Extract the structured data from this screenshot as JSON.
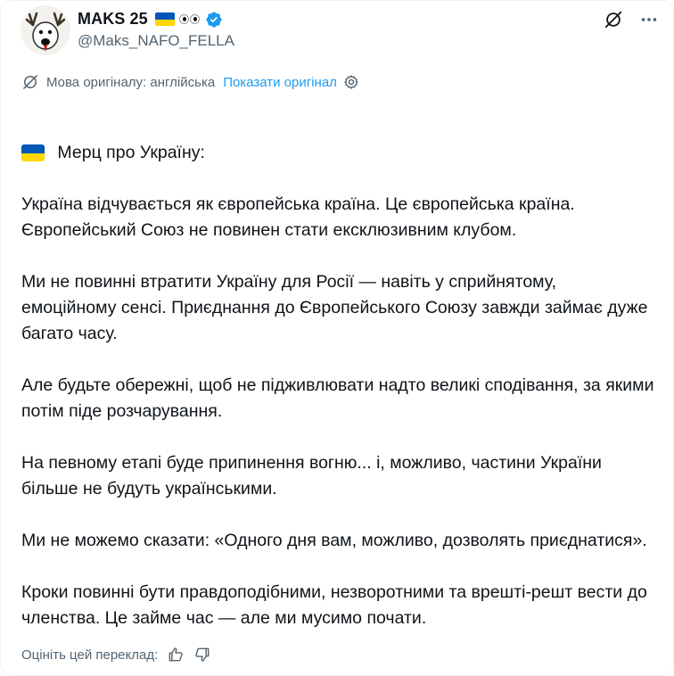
{
  "author": {
    "display_name": "MAKS 25",
    "handle": "@Maks_NAFO_FELLA"
  },
  "header_icons": [
    "grok-slash-icon",
    "more-icon"
  ],
  "translation": {
    "source_language_label": "Мова оригіналу: англійська",
    "show_original_label": "Показати оригінал"
  },
  "tweet": {
    "title": "Мерц про Україну:",
    "paragraphs": [
      "Україна відчувається як європейська країна. Це європейська країна. Європейський Союз не повинен стати ексклюзивним клубом.",
      "Ми не повинні втратити Україну для Росії — навіть у сприйнятому, емоційному сенсі. Приєднання до Європейського Союзу завжди займає дуже багато часу.",
      "Але будьте обережні, щоб не підживлювати надто великі сподівання, за якими потім піде розчарування.",
      "На певному етапі буде припинення вогню... і, можливо, частини України більше не будуть українськими.",
      "Ми не можемо сказати: «Одного дня вам, можливо, дозволять приєднатися».",
      "Кроки повинні бути правдоподібними, незворотними та врешті-решт вести до членства. Це займе час — але ми мусимо почати."
    ]
  },
  "rating": {
    "label": "Оцініть цей переклад:"
  },
  "colors": {
    "text": "#0f1419",
    "secondary": "#536471",
    "link": "#1d9bf0",
    "verified": "#1d9bf0",
    "ua_blue": "#0057b7",
    "ua_yellow": "#ffd700",
    "de_black": "#000000",
    "de_red": "#dd0000",
    "de_gold": "#ffce00"
  }
}
